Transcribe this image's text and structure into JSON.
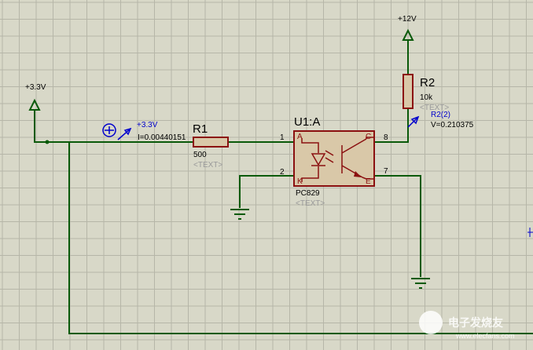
{
  "colors": {
    "background": "#d8d8c8",
    "grid": "#b6b6a8",
    "wire": "#0a5a0a",
    "component": "#8b1010",
    "fill": "#d9c8a8",
    "label": "#000000",
    "placeholder": "#9a9a9a",
    "probe": "#0000cc"
  },
  "power": {
    "left_label": "+3.3V",
    "top_label": "+12V"
  },
  "r1": {
    "ref": "R1",
    "value": "500",
    "text": "<TEXT>"
  },
  "r2": {
    "ref": "R2",
    "value": "10k",
    "text": "<TEXT>"
  },
  "u1": {
    "ref": "U1:A",
    "part": "PC829",
    "text": "<TEXT>",
    "pins": {
      "p1": "1",
      "p2": "2",
      "p7": "7",
      "p8": "8"
    },
    "pin_labels": {
      "anode": "A",
      "cathode": "K",
      "collector": "C",
      "emitter": "E"
    }
  },
  "current_probe": {
    "net": "+3.3V",
    "reading": "I=0.00440151"
  },
  "voltage_probe": {
    "name": "R2(2)",
    "reading": "V=0.210375"
  },
  "watermark": {
    "text": "电子发烧友",
    "url": "www.elecfans.com"
  }
}
